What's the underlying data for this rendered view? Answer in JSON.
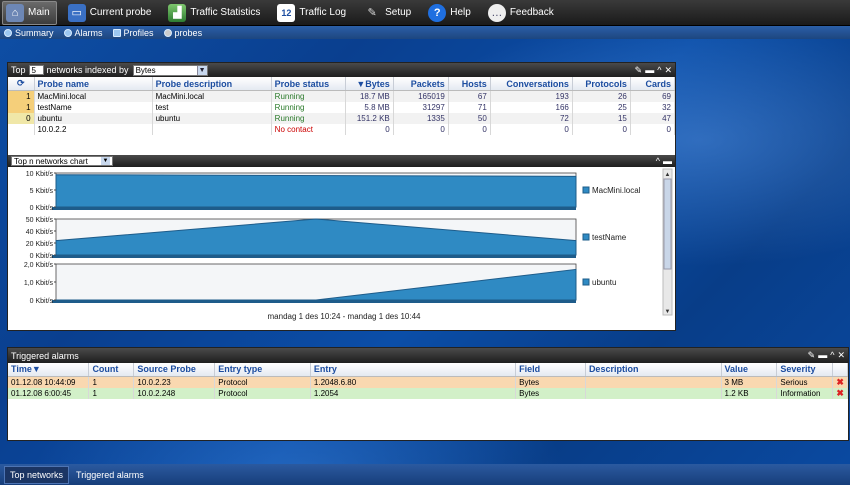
{
  "toolbar": {
    "items": [
      {
        "label": "Main",
        "icon": "home-icon"
      },
      {
        "label": "Current probe",
        "icon": "monitor-icon"
      },
      {
        "label": "Traffic Statistics",
        "icon": "chart-icon"
      },
      {
        "label": "Traffic Log",
        "icon": "calendar-icon",
        "badge": "12"
      },
      {
        "label": "Setup",
        "icon": "wrench-icon"
      },
      {
        "label": "Help",
        "icon": "help-icon"
      },
      {
        "label": "Feedback",
        "icon": "speech-bubble-icon"
      }
    ]
  },
  "subnav": {
    "items": [
      "Summary",
      "Alarms",
      "Profiles",
      "probes"
    ]
  },
  "topn": {
    "prefix": "Top",
    "count": "5",
    "middle": "networks indexed by",
    "index_by": "Bytes",
    "columns": [
      "Probe name",
      "Probe description",
      "Probe status",
      "Bytes",
      "Packets",
      "Hosts",
      "Conversations",
      "Protocols",
      "Cards"
    ],
    "rows": [
      {
        "rank": "1",
        "name": "MacMini.local",
        "desc": "MacMini.local",
        "status": "Running",
        "bytes": "18.7 MB",
        "packets": "165019",
        "hosts": "67",
        "conv": "193",
        "protocols": "26",
        "cards": "69"
      },
      {
        "rank": "1",
        "name": "testName",
        "desc": "test",
        "status": "Running",
        "bytes": "5.8 MB",
        "packets": "31297",
        "hosts": "71",
        "conv": "166",
        "protocols": "25",
        "cards": "32"
      },
      {
        "rank": "0",
        "name": "ubuntu",
        "desc": "ubuntu",
        "status": "Running",
        "bytes": "151.2 KB",
        "packets": "1335",
        "hosts": "50",
        "conv": "72",
        "protocols": "15",
        "cards": "47"
      },
      {
        "rank": "",
        "name": "10.0.2.2",
        "desc": "",
        "status": "No contact",
        "bytes": "0",
        "packets": "0",
        "hosts": "0",
        "conv": "0",
        "protocols": "0",
        "cards": "0"
      }
    ]
  },
  "chart": {
    "selector": "Top n networks chart",
    "xlabel": "mandag 1 des 10:24 - mandag 1 des 10:44"
  },
  "chart_data": {
    "type": "area",
    "xlabel": "mandag 1 des 10:24 - mandag 1 des 10:44",
    "series": [
      {
        "name": "MacMini.local",
        "ticks": [
          "10 Kbit/s",
          "5 Kbit/s",
          "0 Kbit/s"
        ],
        "ylim": [
          0,
          10
        ],
        "x": [
          0,
          1
        ],
        "values": [
          9.5,
          9.0
        ]
      },
      {
        "name": "testName",
        "ticks": [
          "50 Kbit/s",
          "40 Kbit/s",
          "20 Kbit/s",
          "0 Kbit/s"
        ],
        "ylim": [
          0,
          50
        ],
        "x": [
          0,
          0.5,
          1
        ],
        "values": [
          20,
          50,
          20
        ]
      },
      {
        "name": "ubuntu",
        "ticks": [
          "2,0 Kbit/s",
          "1,0 Kbit/s",
          "0 Kbit/s"
        ],
        "ylim": [
          0,
          2
        ],
        "x": [
          0,
          0.5,
          1
        ],
        "values": [
          0,
          0,
          1.7
        ]
      }
    ],
    "legend": "right"
  },
  "alarms": {
    "title": "Triggered alarms",
    "columns": [
      "Time",
      "Count",
      "Source Probe",
      "Entry type",
      "Entry",
      "Field",
      "Description",
      "Value",
      "Severity"
    ],
    "rows": [
      {
        "time": "01.12.08 10:44:09",
        "count": "1",
        "source": "10.0.2.23",
        "type": "Protocol",
        "entry": "1.2048.6.80",
        "field": "Bytes",
        "desc": "",
        "value": "3 MB",
        "severity": "Serious"
      },
      {
        "time": "01.12.08 6:00:45",
        "count": "1",
        "source": "10.0.2.248",
        "type": "Protocol",
        "entry": "1.2054",
        "field": "Bytes",
        "desc": "",
        "value": "1.2 KB",
        "severity": "Information"
      }
    ]
  },
  "bottom_tabs": [
    "Top networks",
    "Triggered alarms"
  ],
  "colors": {
    "accent": "#1c4da0",
    "area_fill": "#2f8ac3",
    "area_dark": "#1e5c8a",
    "serious_row": "#f9d8b0",
    "info_row": "#d2f0c8"
  }
}
